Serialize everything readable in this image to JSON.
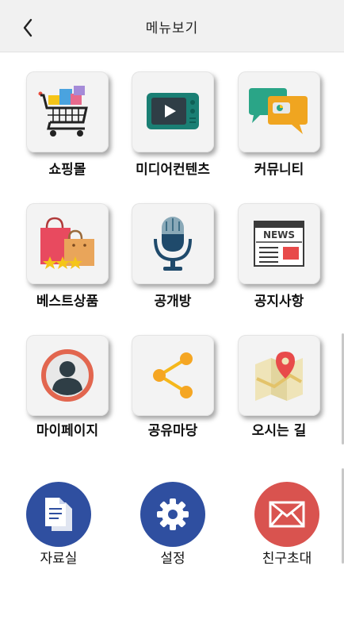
{
  "header": {
    "title": "메뉴보기",
    "back_icon": "chevron-left-icon"
  },
  "menu": {
    "shopping": "쇼핑몰",
    "media": "미디어컨텐츠",
    "community": "커뮤니티",
    "best": "베스트상품",
    "open_room": "공개방",
    "notice": "공지사항",
    "mypage": "마이페이지",
    "share": "공유마당",
    "directions": "오시는 길"
  },
  "news_text": "NEWS",
  "bottom": {
    "archive": "자료실",
    "settings": "설정",
    "invite": "친구초대"
  },
  "colors": {
    "header_bg": "#f1f1f1",
    "tile_bg": "#f3f3f3",
    "archive_circle": "#2f4fa0",
    "settings_circle": "#2f4fa0",
    "invite_circle": "#d9534f"
  }
}
